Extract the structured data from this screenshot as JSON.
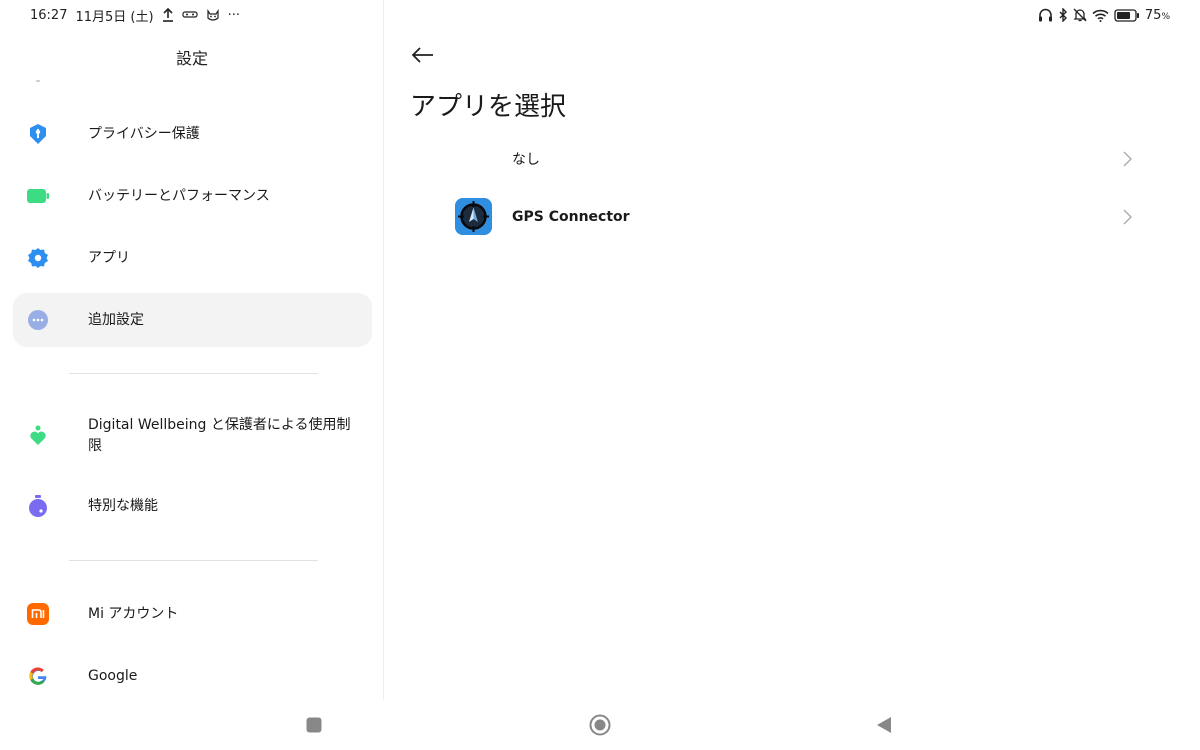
{
  "status_bar": {
    "time": "16:27",
    "date": "11月5日 (土)",
    "more": "···",
    "battery_percent": "75",
    "battery_unit": "%",
    "battery_level": 0.75,
    "icons": [
      "upload-icon",
      "notification-app-icon",
      "cat-icon",
      "headphones-icon",
      "bluetooth-icon",
      "mute-icon",
      "wifi-icon",
      "battery-icon"
    ]
  },
  "sidebar": {
    "title": "設定",
    "items": [
      {
        "label": "プライバシー保護",
        "icon": "privacy-shield-icon",
        "color": "#2d8ff0"
      },
      {
        "label": "バッテリーとパフォーマンス",
        "icon": "battery-performance-icon",
        "color": "#3ddc84"
      },
      {
        "label": "アプリ",
        "icon": "gear-icon",
        "color": "#2d8ff0"
      },
      {
        "label": "追加設定",
        "icon": "more-dots-icon",
        "color": "#9aaee6"
      },
      {
        "label": "Digital Wellbeing と保護者による使用制限",
        "icon": "wellbeing-heart-icon",
        "color": "#3ddc84"
      },
      {
        "label": "特別な機能",
        "icon": "special-features-icon",
        "color": "#7a6cf0"
      },
      {
        "label": "Mi アカウント",
        "icon": "mi-account-icon",
        "color": "#ff6900"
      },
      {
        "label": "Google",
        "icon": "google-icon",
        "color": "#4285f4"
      }
    ],
    "selected_index": 3
  },
  "main": {
    "title": "アプリを選択",
    "rows": [
      {
        "label": "なし"
      },
      {
        "label": "GPS Connector",
        "icon": "gps-connector-app-icon"
      }
    ]
  },
  "navbar": {
    "buttons": [
      "recents-button",
      "home-button",
      "back-button"
    ]
  },
  "colors": {
    "selected_bg": "#f3f3f3",
    "accent_blue": "#2d8ff0"
  }
}
